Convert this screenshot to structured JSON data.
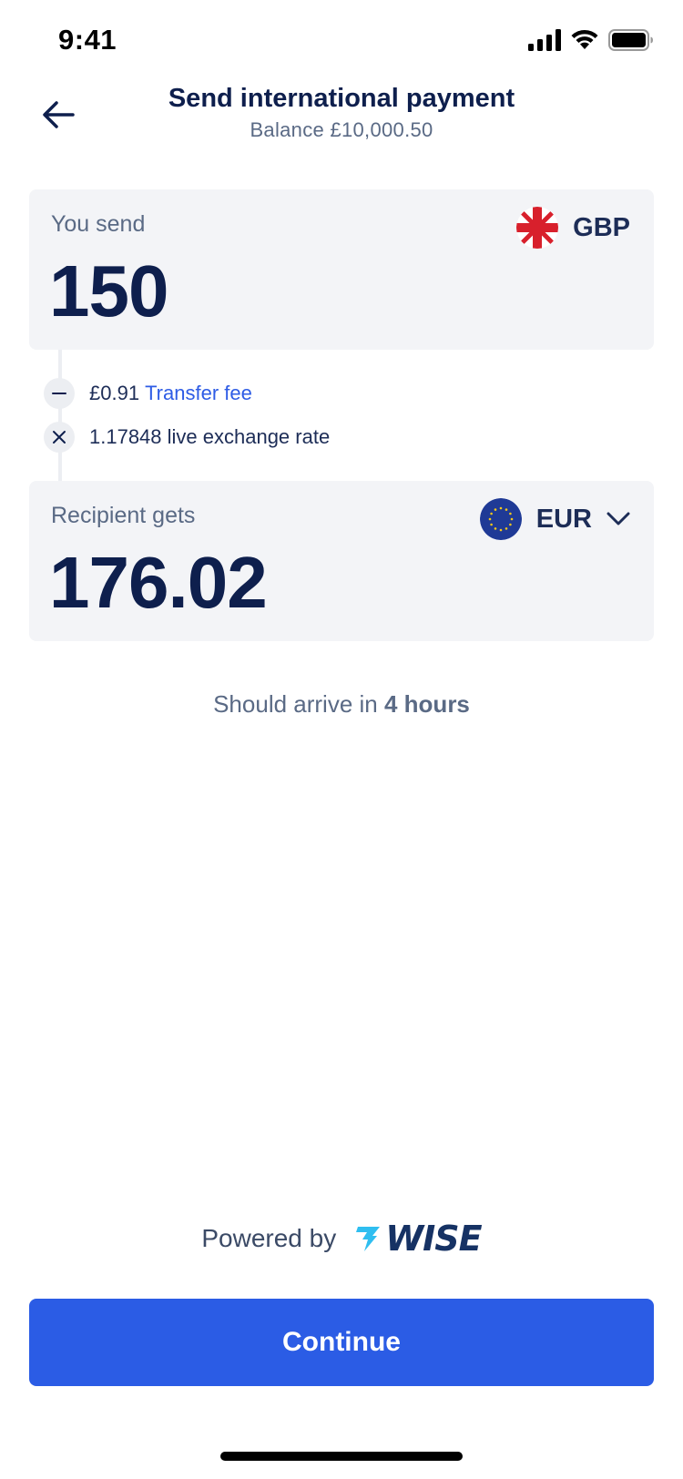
{
  "status_bar": {
    "time": "9:41"
  },
  "header": {
    "title": "Send international payment",
    "balance": "Balance £10,000.50"
  },
  "send": {
    "label": "You send",
    "amount": "150",
    "currency": "GBP",
    "flag_icon": "uk-flag-icon"
  },
  "breakdown": {
    "fee_amount": "£0.91",
    "fee_label": "Transfer fee",
    "rate_text": "1.17848 live exchange rate"
  },
  "receive": {
    "label": "Recipient gets",
    "amount": "176.02",
    "currency": "EUR",
    "flag_icon": "eu-flag-icon"
  },
  "arrival": {
    "prefix": "Should arrive in",
    "time": "4 hours"
  },
  "footer": {
    "powered_by": "Powered by",
    "brand": "WISE"
  },
  "actions": {
    "continue_label": "Continue"
  },
  "colors": {
    "primary": "#2b5ce5",
    "navy": "#0e1f4d",
    "card_bg": "#f3f4f7",
    "muted": "#5a6a85",
    "wise_accent": "#2fbef0"
  }
}
